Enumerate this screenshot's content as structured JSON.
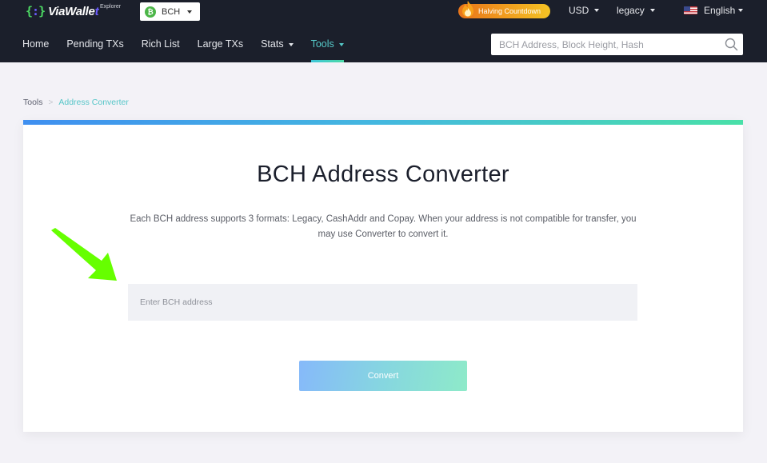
{
  "header": {
    "logo": {
      "mark": "{:}",
      "name_main": "ViaWalle",
      "name_tail": "t",
      "subtitle": "Explorer"
    },
    "coin_selector": {
      "icon": "bitcoin-cash-icon",
      "icon_glyph": "₿",
      "value": "BCH"
    },
    "halving_badge": {
      "icon": "flame-icon",
      "label": "Halving Countdown"
    },
    "currency": {
      "value": "USD"
    },
    "address_format": {
      "value": "legacy"
    },
    "language": {
      "icon": "us-flag-icon",
      "value": "English"
    }
  },
  "nav": {
    "items": [
      {
        "label": "Home",
        "dropdown": false,
        "active": false
      },
      {
        "label": "Pending TXs",
        "dropdown": false,
        "active": false
      },
      {
        "label": "Rich List",
        "dropdown": false,
        "active": false
      },
      {
        "label": "Large TXs",
        "dropdown": false,
        "active": false
      },
      {
        "label": "Stats",
        "dropdown": true,
        "active": false
      },
      {
        "label": "Tools",
        "dropdown": true,
        "active": true
      }
    ]
  },
  "search": {
    "placeholder": "BCH Address, Block Height, Hash",
    "value": "",
    "icon": "search-icon"
  },
  "breadcrumb": {
    "root": "Tools",
    "separator": ">",
    "current": "Address Converter"
  },
  "converter": {
    "title": "BCH Address Converter",
    "description": "Each BCH address supports 3 formats: Legacy, CashAddr and Copay. When your address is not compatible for transfer, you may use Converter to convert it.",
    "input_placeholder": "Enter BCH address",
    "input_value": "",
    "button_label": "Convert"
  },
  "colors": {
    "header_bg": "#1b1f2b",
    "accent": "#56c9c9",
    "page_bg": "#f3f2f7",
    "annotation_arrow": "#66ff00"
  }
}
